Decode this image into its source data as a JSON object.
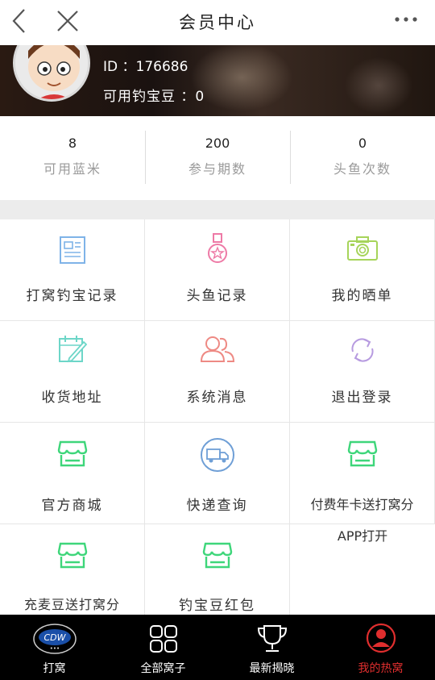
{
  "header": {
    "title": "会员中心",
    "back_icon": "chevron-left-icon",
    "close_icon": "close-icon",
    "more_icon": "more-dots-icon"
  },
  "profile": {
    "id_text": "ID ：176686",
    "beans_text": "可用钓宝豆 ：0"
  },
  "stats": [
    {
      "value": "8",
      "label": "可用蓝米"
    },
    {
      "value": "200",
      "label": "参与期数"
    },
    {
      "value": "0",
      "label": "头鱼次数"
    }
  ],
  "menu": [
    {
      "label": "打窝钓宝记录",
      "icon": "record-list-icon",
      "color": "#7fb3e8"
    },
    {
      "label": "头鱼记录",
      "icon": "medal-icon",
      "color": "#ee7aa6"
    },
    {
      "label": "我的晒单",
      "icon": "camera-icon",
      "color": "#a6d45a"
    },
    {
      "label": "收货地址",
      "icon": "edit-calendar-icon",
      "color": "#6dd6c8"
    },
    {
      "label": "系统消息",
      "icon": "users-icon",
      "color": "#ee8a84"
    },
    {
      "label": "退出登录",
      "icon": "refresh-icon",
      "color": "#b79be0"
    },
    {
      "label": "官方商城",
      "icon": "store-icon",
      "color": "#3ed67a"
    },
    {
      "label": "快递查询",
      "icon": "delivery-truck-icon",
      "color": "#6f9fd6"
    },
    {
      "label": "付费年卡送打窝分",
      "icon": "store-icon",
      "color": "#3ed67a"
    },
    {
      "label": "充麦豆送打窝分",
      "icon": "store-icon",
      "color": "#3ed67a"
    },
    {
      "label": "钓宝豆红包",
      "icon": "store-icon",
      "color": "#3ed67a"
    }
  ],
  "extra_text": "APP打开",
  "tabbar": {
    "items": [
      {
        "label": "打窝",
        "icon": "brand-logo-icon"
      },
      {
        "label": "全部窝子",
        "icon": "grid-icon"
      },
      {
        "label": "最新揭晓",
        "icon": "trophy-icon"
      },
      {
        "label": "我的热窝",
        "icon": "user-circle-icon"
      }
    ],
    "active_color": "#e02e2e"
  }
}
